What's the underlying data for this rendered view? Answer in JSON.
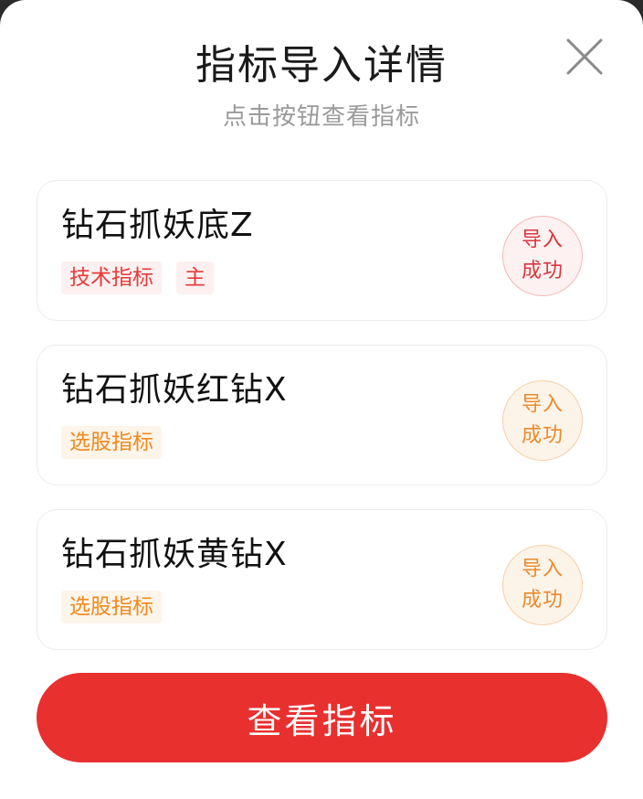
{
  "dialog": {
    "title": "指标导入详情",
    "subtitle": "点击按钮查看指标"
  },
  "items": [
    {
      "name": "钻石抓妖底Z",
      "tags": [
        "技术指标",
        "主"
      ],
      "status_line1": "导入",
      "status_line2": "成功",
      "theme": "red"
    },
    {
      "name": "钻石抓妖红钻X",
      "tags": [
        "选股指标"
      ],
      "status_line1": "导入",
      "status_line2": "成功",
      "theme": "orange"
    },
    {
      "name": "钻石抓妖黄钻X",
      "tags": [
        "选股指标"
      ],
      "status_line1": "导入",
      "status_line2": "成功",
      "theme": "orange"
    }
  ],
  "button": {
    "label": "查看指标"
  },
  "colors": {
    "primary_red": "#e8302f",
    "tag_red": "#e63a3a",
    "tag_orange": "#f08a1c"
  },
  "icons": {
    "close": "close-icon"
  }
}
